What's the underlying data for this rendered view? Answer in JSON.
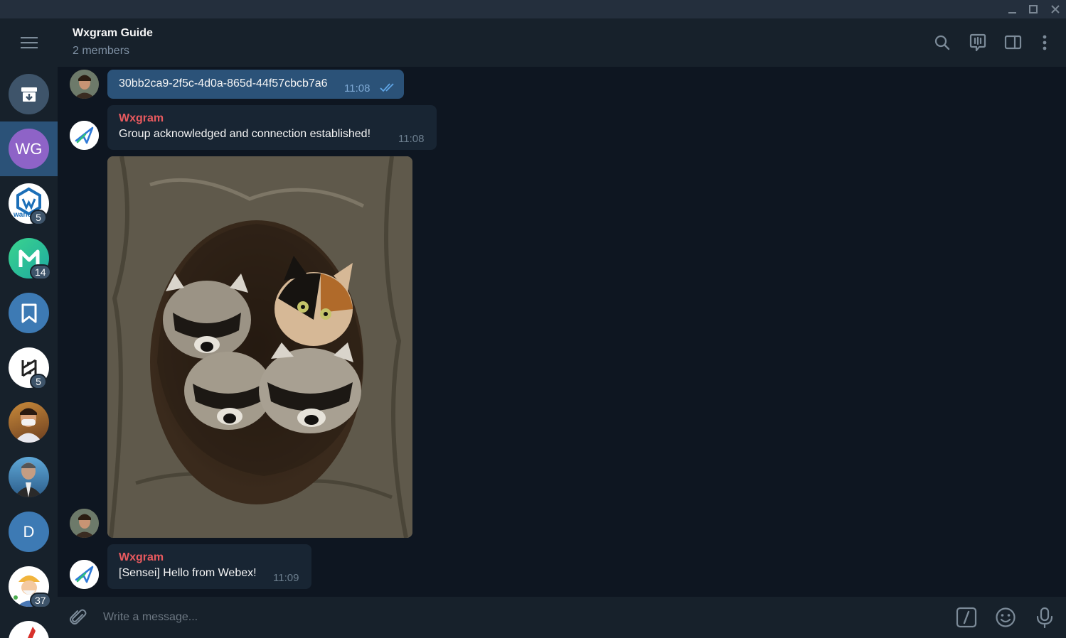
{
  "window": {
    "controls": [
      "minimize-icon",
      "maximize-icon",
      "close-icon"
    ]
  },
  "sidebar": {
    "menu_icon": "hamburger-icon",
    "items": [
      {
        "name": "archive",
        "icon": "archive-icon",
        "color": "#3e546a"
      },
      {
        "name": "wxgram-guide",
        "initials": "WG",
        "color": "#8e63c7",
        "active": true
      },
      {
        "name": "wanchain",
        "badge": "5",
        "text": "wanch"
      },
      {
        "name": "m-chat",
        "badge": "14"
      },
      {
        "name": "saved-messages",
        "icon": "bookmark-icon",
        "color": "#3d7ab4"
      },
      {
        "name": "h-chat",
        "badge": "5"
      },
      {
        "name": "person-mask"
      },
      {
        "name": "person-suit"
      },
      {
        "name": "d-chat",
        "initials": "D",
        "color": "#3d7ab4"
      },
      {
        "name": "cartoon-chat",
        "badge": "37"
      },
      {
        "name": "red-chat"
      }
    ]
  },
  "header": {
    "title": "Wxgram Guide",
    "subtitle": "2 members",
    "icons": [
      "search-icon",
      "voice-chat-icon",
      "sidebar-toggle-icon",
      "more-icon"
    ]
  },
  "messages": [
    {
      "type": "outgoing",
      "text": "30bb2ca9-2f5c-4d0a-865d-44f57cbcb7a6",
      "time": "11:08",
      "status": "read"
    },
    {
      "type": "incoming",
      "sender": "Wxgram",
      "text": "Group acknowledged and connection established!",
      "time": "11:08"
    },
    {
      "type": "photo",
      "description": "raccoons-and-kitten-in-tree"
    },
    {
      "type": "incoming",
      "sender": "Wxgram",
      "text": "[Sensei] Hello from Webex!",
      "time": "11:09"
    }
  ],
  "composer": {
    "placeholder": "Write a message...",
    "icons": [
      "attach-icon",
      "commands-icon",
      "emoji-icon",
      "microphone-icon"
    ]
  },
  "colors": {
    "accent": "#2b5278",
    "sender_name": "#e95a5f",
    "background": "#0e1621",
    "panel": "#17212b"
  }
}
